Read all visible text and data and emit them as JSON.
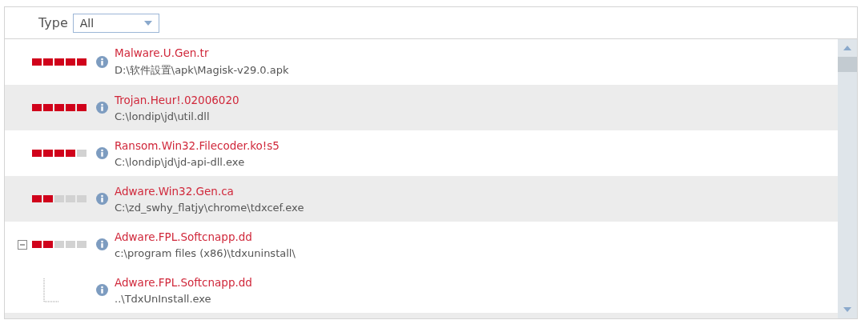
{
  "filter": {
    "label": "Type",
    "value": "All"
  },
  "threats": [
    {
      "name": "Malware.U.Gen.tr",
      "path": "D:\\软件設置\\apk\\Magisk-v29.0.apk",
      "stars": 5
    },
    {
      "name": "Trojan.Heur!.02006020",
      "path": "C:\\londip\\jd\\util.dll",
      "stars": 5
    },
    {
      "name": "Ransom.Win32.Filecoder.ko!s5",
      "path": "C:\\londip\\jd\\jd-api-dll.exe",
      "stars": 4
    },
    {
      "name": "Adware.Win32.Gen.ca",
      "path": "C:\\zd_swhy_flatjy\\chrome\\tdxcef.exe",
      "stars": 2
    },
    {
      "name": "Adware.FPL.Softcnapp.dd",
      "path": "c:\\program files (x86)\\tdxuninstall\\",
      "stars": 2,
      "expanded": true,
      "children": [
        {
          "name": "Adware.FPL.Softcnapp.dd",
          "path": "..\\TdxUnInstall.exe"
        }
      ]
    }
  ]
}
